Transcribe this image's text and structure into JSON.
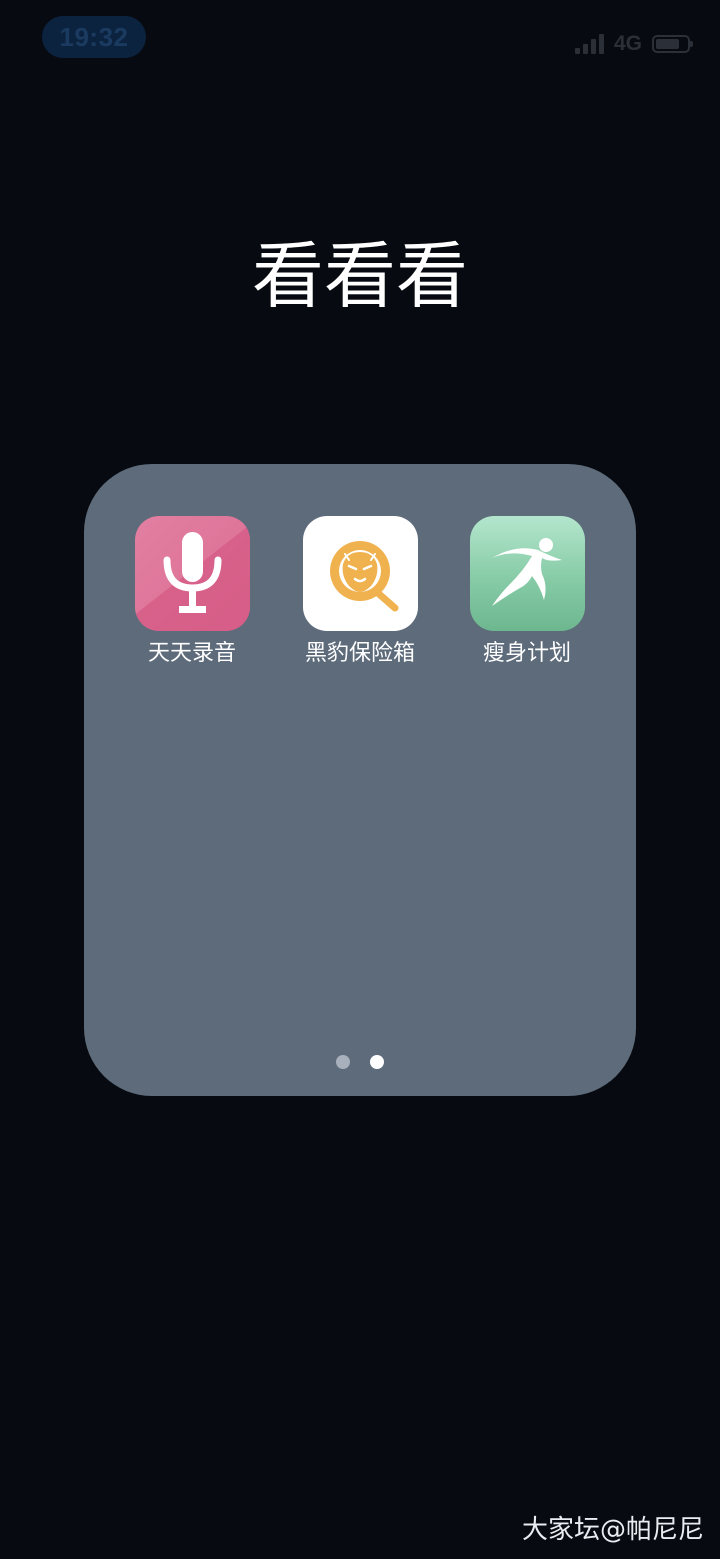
{
  "status_bar": {
    "time": "19:32",
    "network": "4G",
    "battery_level": 0.75,
    "signal_bars": 4
  },
  "folder": {
    "title": "看看看",
    "apps": [
      {
        "label": "天天录音",
        "icon": "microphone-icon"
      },
      {
        "label": "黑豹保险箱",
        "icon": "panther-vault-icon"
      },
      {
        "label": "瘦身计划",
        "icon": "runner-icon"
      }
    ],
    "page_count": 2,
    "current_page": 2
  },
  "watermark": "大家坛@帕尼尼",
  "colors": {
    "background": "#070a10",
    "folder_panel": "#5d6b7b",
    "recorder_pink": "#e27fa1",
    "vault_gold": "#f0b24e",
    "fitness_green": "#86cba6"
  }
}
